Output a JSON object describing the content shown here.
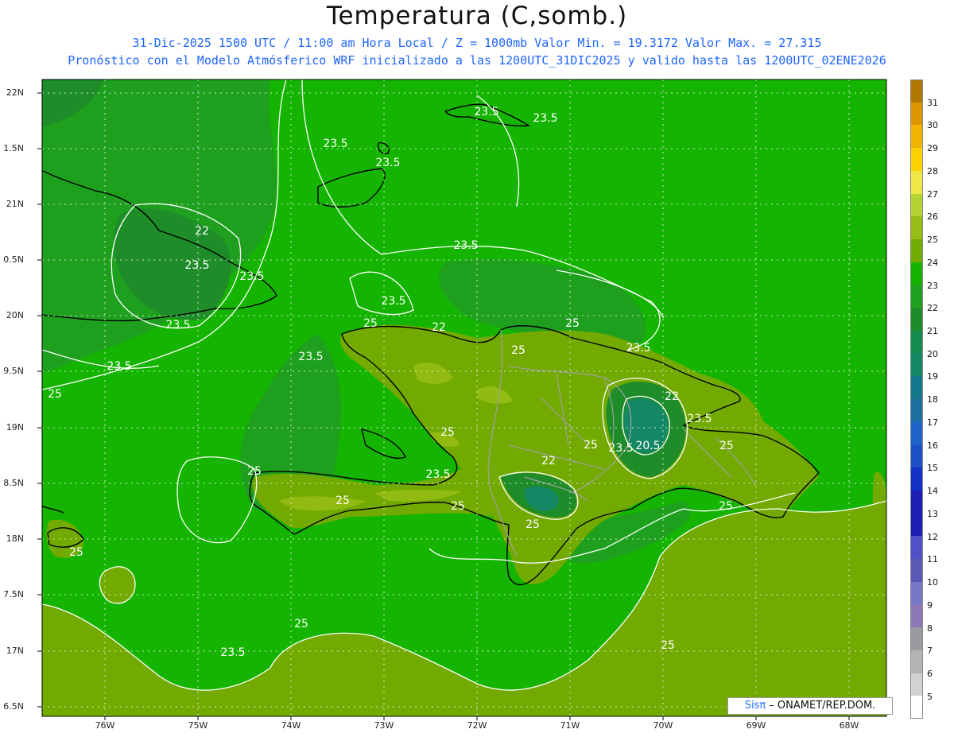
{
  "title": "Temperatura (C,somb.)",
  "subtitle_line1": "31-Dic-2025 1500 UTC / 11:00 am Hora Local / Z = 1000mb   Valor Min. = 19.3172  Valor Max. = 27.315",
  "subtitle_line2": "Pronóstico con el Modelo Atmósferico WRF inicializado a las 1200UTC_31DIC2025 y valido hasta las  1200UTC_02ENE2026",
  "lat_labels": [
    "22N",
    "1.5N",
    "21N",
    "0.5N",
    "20N",
    "9.5N",
    "19N",
    "8.5N",
    "18N",
    "7.5N",
    "17N",
    "6.5N"
  ],
  "lon_labels": [
    "76W",
    "75W",
    "74W",
    "73W",
    "72W",
    "71W",
    "70W",
    "69W",
    "68W"
  ],
  "colorbar": {
    "labels": [
      "31",
      "30",
      "29",
      "28",
      "27",
      "26",
      "25",
      "24",
      "23",
      "22",
      "21",
      "20",
      "19",
      "18",
      "17",
      "16",
      "15",
      "14",
      "13",
      "12",
      "11",
      "10",
      "9",
      "8",
      "7",
      "6",
      "5"
    ],
    "colors": [
      "#b07800",
      "#dc9600",
      "#f0b400",
      "#fad200",
      "#f0e646",
      "#b4d232",
      "#96be14",
      "#73aa00",
      "#14b400",
      "#1ea01e",
      "#1e8c28",
      "#148c50",
      "#148764",
      "#14788c",
      "#1e6ea0",
      "#1e64c8",
      "#1e50c8",
      "#1432c8",
      "#1e1eb4",
      "#1e1eb4",
      "#5050c8",
      "#5a5ab4",
      "#7878c8",
      "#8c78b4",
      "#9a9aa0",
      "#b4b4b4",
      "#d2d2d2",
      "#ffffff"
    ]
  },
  "contour_labels": [
    "23.5",
    "23.5",
    "23.5",
    "23.5",
    "22",
    "23.5",
    "23.5",
    "23.5",
    "23.5",
    "22",
    "23.5",
    "23.5",
    "25",
    "23.5",
    "25",
    "25",
    "23.5",
    "22",
    "23.5",
    "25",
    "20.5",
    "23.5",
    "25",
    "22",
    "25",
    "23.5",
    "25",
    "25",
    "25",
    "25",
    "25",
    "25",
    "25",
    "25",
    "23.5",
    "25"
  ],
  "credit": {
    "brand": "Sisπ",
    "text": " – ONAMET/REP.DOM."
  }
}
